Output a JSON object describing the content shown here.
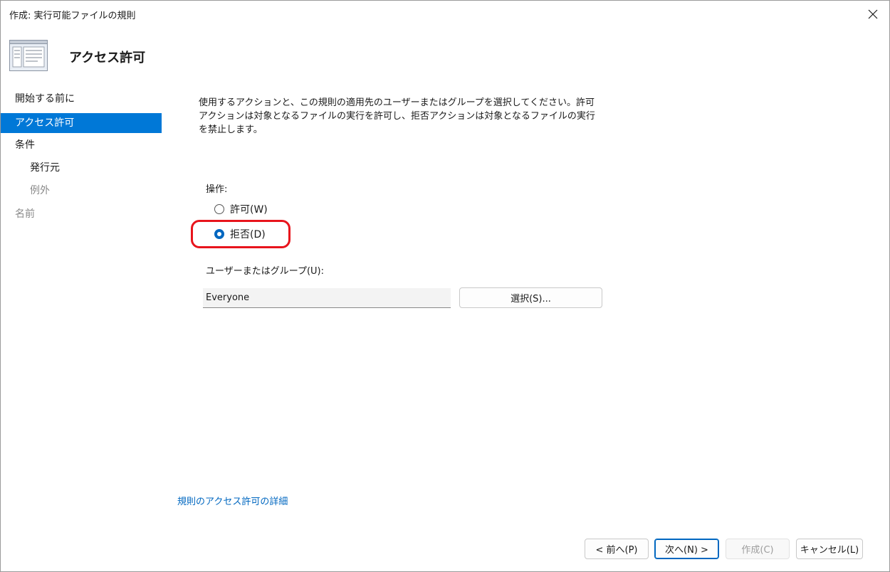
{
  "window": {
    "title": "作成: 実行可能ファイルの規則",
    "close_icon": "close-icon"
  },
  "header": {
    "title": "アクセス許可",
    "icon": "rule-document-icon"
  },
  "sidebar": {
    "items": [
      {
        "label": "開始する前に",
        "state": "normal"
      },
      {
        "label": "アクセス許可",
        "state": "selected"
      },
      {
        "label": "条件",
        "state": "normal"
      },
      {
        "label": "発行元",
        "state": "normal"
      },
      {
        "label": "例外",
        "state": "disabled"
      },
      {
        "label": "名前",
        "state": "disabled"
      }
    ]
  },
  "main": {
    "description": "使用するアクションと、この規則の適用先のユーザーまたはグループを選択してください。許可アクションは対象となるファイルの実行を許可し、拒否アクションは対象となるファイルの実行を禁止します。",
    "action_label": "操作:",
    "actions": [
      {
        "label": "許可(W)",
        "checked": false
      },
      {
        "label": "拒否(D)",
        "checked": true
      }
    ],
    "group_label": "ユーザーまたはグループ(U):",
    "group_value": "Everyone",
    "select_button": "選択(S)...",
    "details_link": "規則のアクセス許可の詳細"
  },
  "footer": {
    "back": "< 前へ(P)",
    "next": "次へ(N) >",
    "create": "作成(C)",
    "cancel": "キャンセル(L)"
  },
  "colors": {
    "accent": "#0078d7",
    "highlight": "#e8141c",
    "link": "#0067c0"
  }
}
